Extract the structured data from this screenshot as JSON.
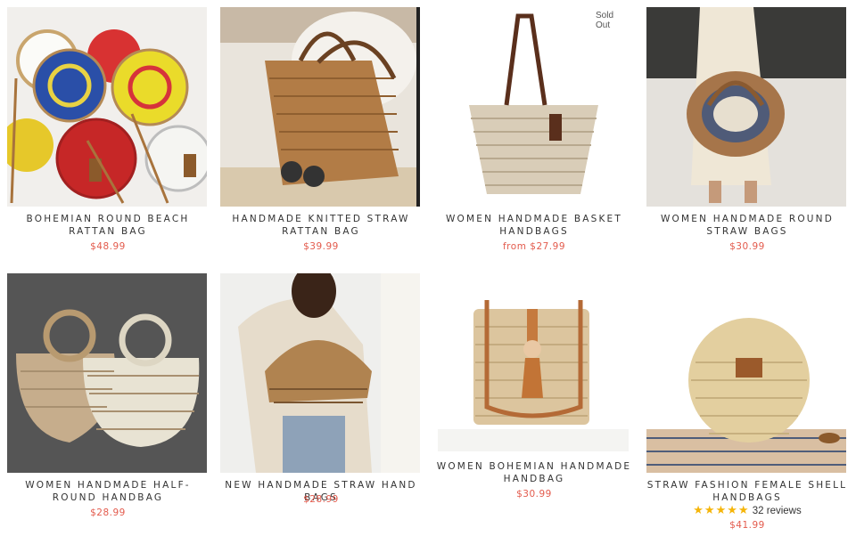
{
  "products": [
    {
      "title": "Bohemian Round Beach Rattan Bag",
      "price": "$48.99"
    },
    {
      "title": "Handmade Knitted Straw Rattan Bag",
      "price": "$39.99"
    },
    {
      "title": "Women Handmade Basket Handbags",
      "price": "from $27.99",
      "badge": "Sold Out"
    },
    {
      "title": "Women Handmade Round Straw Bags",
      "price": "$30.99"
    },
    {
      "title": "Women Handmade Half-Round Handbag",
      "price": "$28.99"
    },
    {
      "title": "New Handmade Straw Hand Bags",
      "price": "$28.99"
    },
    {
      "title": "Women Bohemian Handmade Handbag",
      "price": "$30.99"
    },
    {
      "title": "Straw Fashion Female Shell Handbags",
      "price": "$41.99",
      "rating_stars": "★★★★★",
      "reviews": "32 reviews",
      "rating": 5
    }
  ],
  "colors": {
    "price": "#e35b4d",
    "star": "#f5b50a",
    "title": "#333333"
  }
}
